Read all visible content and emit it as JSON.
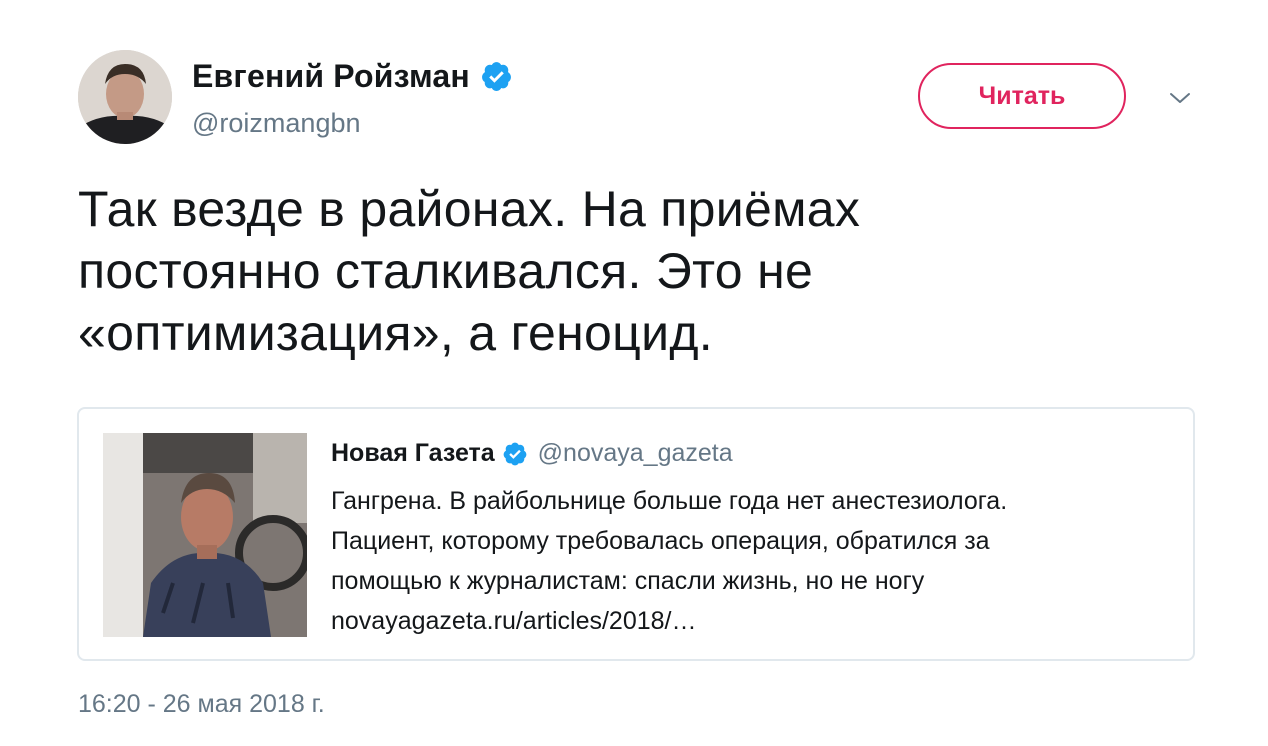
{
  "author": {
    "name": "Евгений Ройзман",
    "handle": "@roizmangbn",
    "verified_icon": "verified-badge-icon"
  },
  "follow_button": {
    "label": "Читать"
  },
  "menu": {
    "icon": "chevron-down-icon"
  },
  "tweet": {
    "text_lines": [
      "Так везде в районах. На приёмах",
      "постоянно сталкивался. Это не",
      "«оптимизация», а геноцид."
    ],
    "timestamp": "16:20 - 26 мая 2018 г."
  },
  "quote": {
    "name": "Новая Газета",
    "handle": "@novaya_gazeta",
    "text_lines": [
      "Гангрена. В райбольнице больше года нет анестезиолога.",
      "Пациент, которому требовалась операция, обратился за",
      "помощью к журналистам: спасли жизнь, но не ногу",
      "novayagazeta.ru/articles/2018/…"
    ]
  },
  "colors": {
    "accent": "#e0245e",
    "verified": "#1da1f2",
    "secondary_text": "#657786",
    "border": "#e1e8ed"
  }
}
